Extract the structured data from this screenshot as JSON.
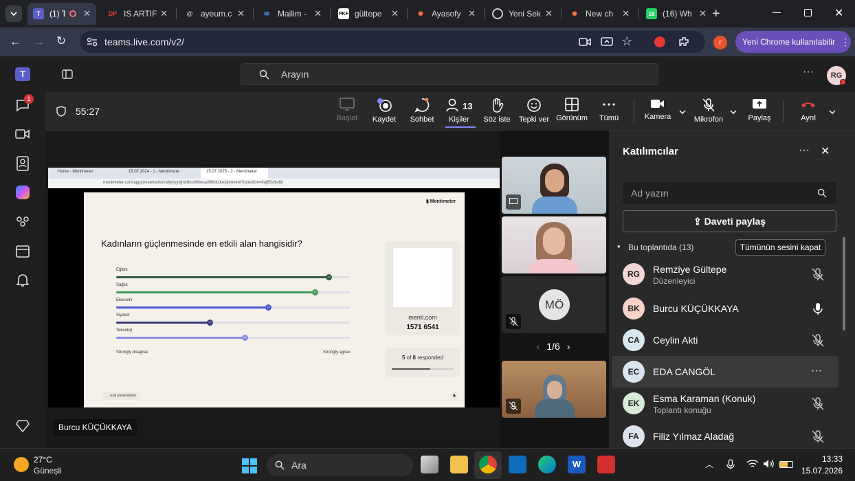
{
  "browser": {
    "tabs": [
      {
        "title": "(1) T",
        "active": true
      },
      {
        "title": "IS ARTIF"
      },
      {
        "title": "ayeum.c"
      },
      {
        "title": "Mailim -"
      },
      {
        "title": "gültepe"
      },
      {
        "title": "Ayasofy"
      },
      {
        "title": "Yeni Sek"
      },
      {
        "title": "New ch"
      },
      {
        "title": "(16) Wh"
      }
    ],
    "url": "teams.live.com/v2/",
    "profile_button": "Yeni Chrome kullanılabilir",
    "profile_initial": "r"
  },
  "teams": {
    "search_placeholder": "Arayın",
    "user_initials": "RG",
    "chat_badge": "1",
    "timer": "55:27",
    "toolbar": {
      "start": "Başlat",
      "record": "Kaydet",
      "chat": "Sohbet",
      "people": "Kişiler",
      "people_count": "13",
      "raise": "Söz iste",
      "react": "Tepki ver",
      "view": "Görünüm",
      "more": "Tümü",
      "camera": "Kamera",
      "mic": "Mikrofon",
      "share": "Paylaş",
      "leave": "Ayrıl"
    },
    "presenter_name": "Burcu KÜÇÜKKAYA",
    "shared": {
      "browser_tabs": [
        "Home - Mentimeter",
        "15.07.2024 - 1 - Mentimeter",
        "15.07.2025 - 2 - Mentimeter"
      ],
      "url": "mentimeter.com/app/presentation/a9yxyydjmcfbcdi6fwcad96hkzkes/present?question=8aj65s8sllj8",
      "brand": "Mentimeter",
      "question": "Kadınların güçlenmesinde en etkili alan hangisidir?",
      "rows": [
        {
          "label": "Eğitim",
          "value": 0.91,
          "color": "#2e5d3e"
        },
        {
          "label": "Sağlık",
          "value": 0.85,
          "color": "#3f9d55"
        },
        {
          "label": "Ekonomi",
          "value": 0.65,
          "color": "#4a5bd0"
        },
        {
          "label": "Siyaset",
          "value": 0.4,
          "color": "#373a7a"
        },
        {
          "label": "Teknoloji",
          "value": 0.55,
          "color": "#8b8fe0"
        }
      ],
      "dot_labels": [
        "4.4",
        "4.2",
        "3.4",
        "2.4",
        "3.3"
      ],
      "scale_left": "Strongly disagree",
      "scale_right": "Strongly agree",
      "menti_site": "menti.com",
      "menti_code": "1571 6541",
      "responded_count": "5",
      "responded_total": "8",
      "responded_of": "of",
      "responded_suffix": "responded",
      "responded_fraction": 0.625,
      "end_presentation": "End presentation"
    },
    "video_tiles": {
      "initials": "MÖ",
      "pager": "1/6"
    },
    "participants": {
      "title": "Katılımcılar",
      "search_placeholder": "Ad yazın",
      "invite": "Daveti paylaş",
      "section": "Bu toplantıda (13)",
      "mute_all": "Tümünün sesini kapat",
      "list": [
        {
          "initials": "RG",
          "name": "Remziye Gültepe",
          "sub": "Düzenleyici",
          "mic": "off",
          "bg": "#f3d6d6"
        },
        {
          "initials": "BK",
          "name": "Burcu KÜÇÜKKAYA",
          "sub": "",
          "mic": "on",
          "bg": "#f6d2c7"
        },
        {
          "initials": "CA",
          "name": "Ceylin Akti",
          "sub": "",
          "mic": "off",
          "bg": "#d7e8f0"
        },
        {
          "initials": "EC",
          "name": "EDA CANGÖL",
          "sub": "",
          "mic": "more",
          "bg": "#d9e4f0"
        },
        {
          "initials": "EK",
          "name": "Esma Karaman (Konuk)",
          "sub": "Toplantı konuğu",
          "mic": "off",
          "bg": "#d6ecd9"
        },
        {
          "initials": "FA",
          "name": "Filiz Yılmaz Aladağ",
          "sub": "",
          "mic": "off",
          "bg": "#dde3ee"
        }
      ]
    }
  },
  "taskbar": {
    "weather_temp": "27°C",
    "weather_text": "Güneşli",
    "search": "Ara",
    "time": "13:33",
    "date": "15.07.2026"
  },
  "colors": {
    "accent": "#7f85f5",
    "leave": "#e0443e",
    "profile": "#6a4fb8"
  }
}
